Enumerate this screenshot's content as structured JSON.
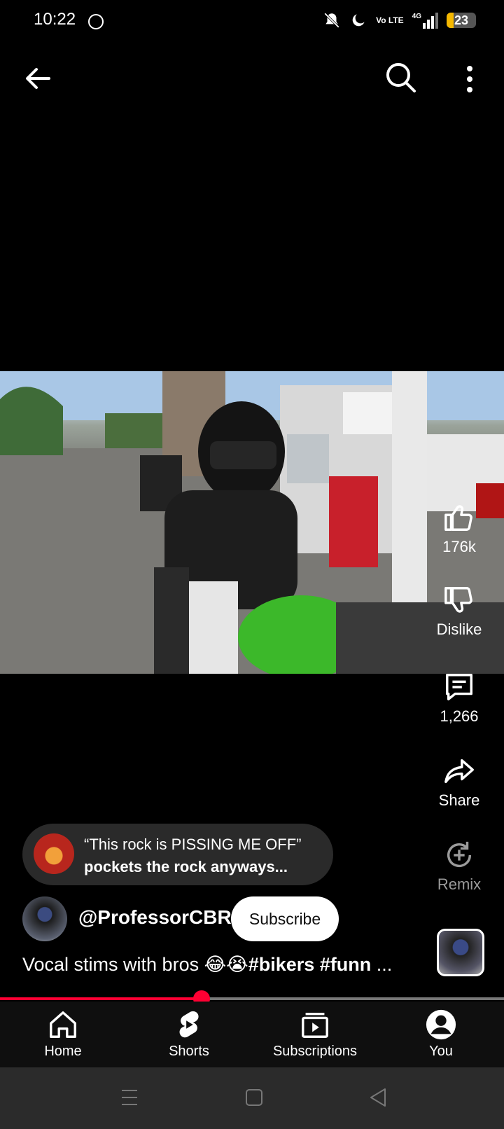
{
  "status_bar": {
    "time": "10:22",
    "network": "4G",
    "volte": "Vo LTE",
    "battery": "23",
    "battery_level_percent": 23
  },
  "top_bar": {
    "back_icon": "arrow-left-icon",
    "search_icon": "search-icon",
    "more_icon": "more-vert-icon"
  },
  "actions": {
    "like_count": "176k",
    "dislike_label": "Dislike",
    "comment_count": "1,266",
    "share_label": "Share",
    "remix_label": "Remix"
  },
  "comment_preview": {
    "line1": "“This rock is PISSING ME OFF”",
    "line2": "pockets the rock anyways..."
  },
  "channel": {
    "handle": "@ProfessorCBR",
    "subscribe_label": "Subscribe"
  },
  "caption": {
    "text": "Vocal stims with bros 😂😭",
    "hashtags": "#bikers #funn",
    "ellipsis": "..."
  },
  "progress": {
    "fraction": 0.4
  },
  "bottom_nav": {
    "items": [
      {
        "label": "Home",
        "icon": "home-icon"
      },
      {
        "label": "Shorts",
        "icon": "shorts-icon"
      },
      {
        "label": "Subscriptions",
        "icon": "subscriptions-icon"
      },
      {
        "label": "You",
        "icon": "account-icon"
      }
    ]
  },
  "colors": {
    "accent_red": "#ff0033",
    "battery_yellow": "#f5b800",
    "nav_bg": "#0f0f0f"
  }
}
